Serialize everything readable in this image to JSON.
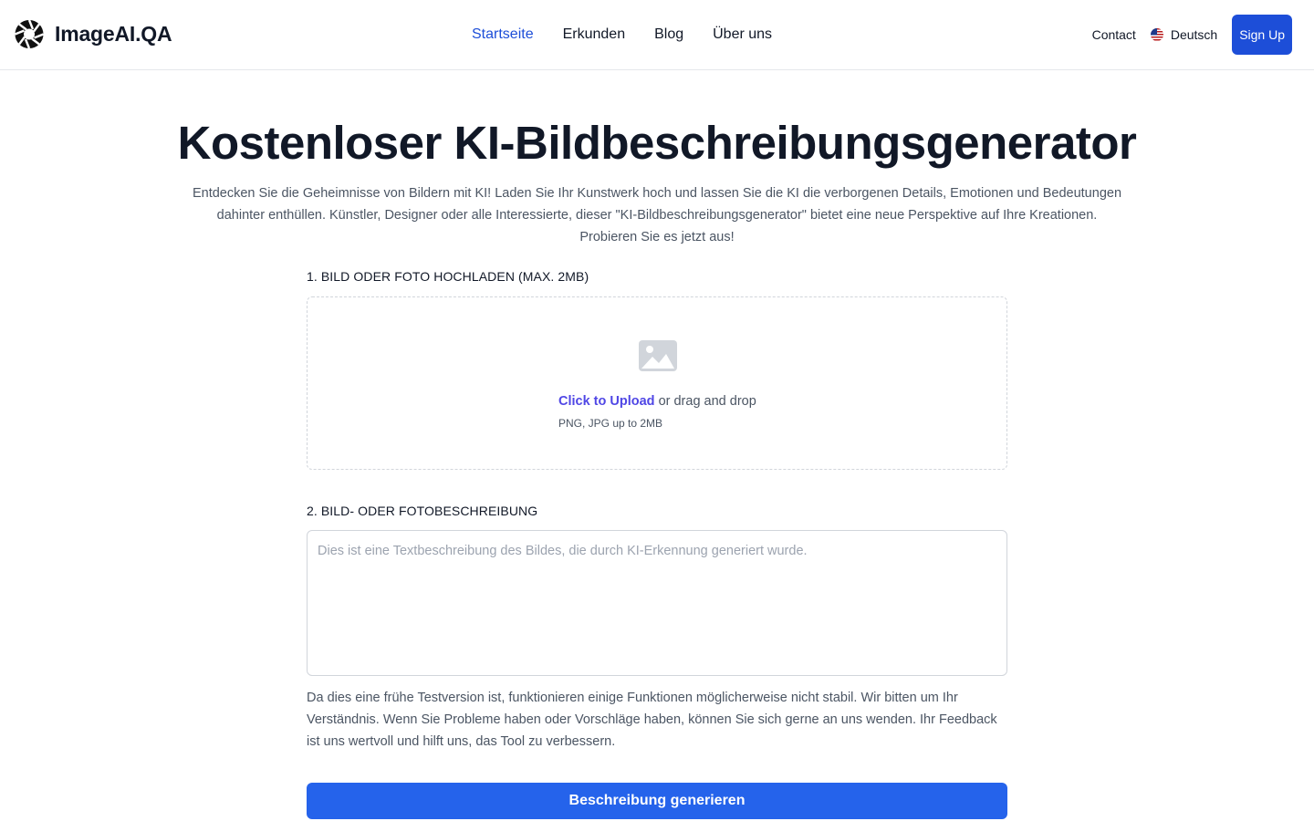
{
  "brand": {
    "name": "ImageAI.QA"
  },
  "nav": {
    "items": [
      {
        "label": "Startseite",
        "active": true
      },
      {
        "label": "Erkunden",
        "active": false
      },
      {
        "label": "Blog",
        "active": false
      },
      {
        "label": "Über uns",
        "active": false
      }
    ]
  },
  "header": {
    "contact_label": "Contact",
    "language_label": "Deutsch",
    "language_icon": "us-flag-icon",
    "signup_label": "Sign Up"
  },
  "hero": {
    "title": "Kostenloser KI-Bildbeschreibungsgenerator",
    "subtitle": "Entdecken Sie die Geheimnisse von Bildern mit KI! Laden Sie Ihr Kunstwerk hoch und lassen Sie die KI die verborgenen Details, Emotionen und Bedeutungen dahinter enthüllen. Künstler, Designer oder alle Interessierte, dieser \"KI-Bildbeschreibungsgenerator\" bietet eine neue Perspektive auf Ihre Kreationen. Probieren Sie es jetzt aus!"
  },
  "upload": {
    "label": "1. BILD ODER FOTO HOCHLADEN (MAX. 2MB)",
    "icon": "image-icon",
    "link_label": "Click to Upload",
    "drag_text": " or drag and drop",
    "hint": "PNG, JPG up to 2MB"
  },
  "description": {
    "label": "2. BILD- ODER FOTOBESCHREIBUNG",
    "value": "",
    "placeholder": "Dies ist eine Textbeschreibung des Bildes, die durch KI-Erkennung generiert wurde."
  },
  "notice": "Da dies eine frühe Testversion ist, funktionieren einige Funktionen möglicherweise nicht stabil. Wir bitten um Ihr Verständnis. Wenn Sie Probleme haben oder Vorschläge haben, können Sie sich gerne an uns wenden. Ihr Feedback ist uns wertvoll und hilft uns, das Tool zu verbessern.",
  "generate_label": "Beschreibung generieren",
  "colors": {
    "primary": "#2563eb",
    "nav_active": "#1d4ed8",
    "link": "#4f46e5",
    "text": "#111827",
    "muted": "#4b5563"
  }
}
